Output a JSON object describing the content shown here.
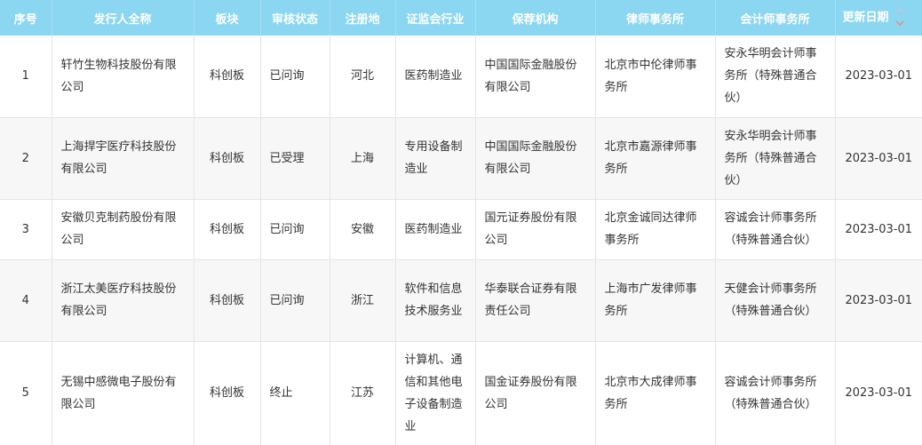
{
  "headers": {
    "index": "序号",
    "issuer": "发行人全称",
    "board": "板块",
    "status": "审核状态",
    "region": "注册地",
    "industry": "证监会行业",
    "sponsor": "保荐机构",
    "law_firm": "律师事务所",
    "accounting_firm": "会计师事务所",
    "updated": "更新日期"
  },
  "sort_colors": {
    "up": "#c8c8c8",
    "down": "#f08a6a"
  },
  "rows": [
    {
      "index": "1",
      "issuer": "轩竹生物科技股份有限公司",
      "board": "科创板",
      "status": "已问询",
      "region": "河北",
      "industry": "医药制造业",
      "sponsor": "中国国际金融股份有限公司",
      "law_firm": "北京市中伦律师事务所",
      "accounting_firm": "安永华明会计师事务所（特殊普通合伙）",
      "updated": "2023-03-01"
    },
    {
      "index": "2",
      "issuer": "上海捍宇医疗科技股份有限公司",
      "board": "科创板",
      "status": "已受理",
      "region": "上海",
      "industry": "专用设备制造业",
      "sponsor": "中国国际金融股份有限公司",
      "law_firm": "北京市嘉源律师事务所",
      "accounting_firm": "安永华明会计师事务所（特殊普通合伙）",
      "updated": "2023-03-01"
    },
    {
      "index": "3",
      "issuer": "安徽贝克制药股份有限公司",
      "board": "科创板",
      "status": "已问询",
      "region": "安徽",
      "industry": "医药制造业",
      "sponsor": "国元证券股份有限公司",
      "law_firm": "北京金诚同达律师事务所",
      "accounting_firm": "容诚会计师事务所（特殊普通合伙）",
      "updated": "2023-03-01"
    },
    {
      "index": "4",
      "issuer": "浙江太美医疗科技股份有限公司",
      "board": "科创板",
      "status": "已问询",
      "region": "浙江",
      "industry": "软件和信息技术服务业",
      "sponsor": "华泰联合证券有限责任公司",
      "law_firm": "上海市广发律师事务所",
      "accounting_firm": "天健会计师事务所（特殊普通合伙）",
      "updated": "2023-03-01"
    },
    {
      "index": "5",
      "issuer": "无锡中感微电子股份有限公司",
      "board": "科创板",
      "status": "终止",
      "region": "江苏",
      "industry": "计算机、通信和其他电子设备制造业",
      "sponsor": "国金证券股份有限公司",
      "law_firm": "北京市大成律师事务所",
      "accounting_firm": "容诚会计师事务所（特殊普通合伙）",
      "updated": "2023-03-01"
    }
  ]
}
